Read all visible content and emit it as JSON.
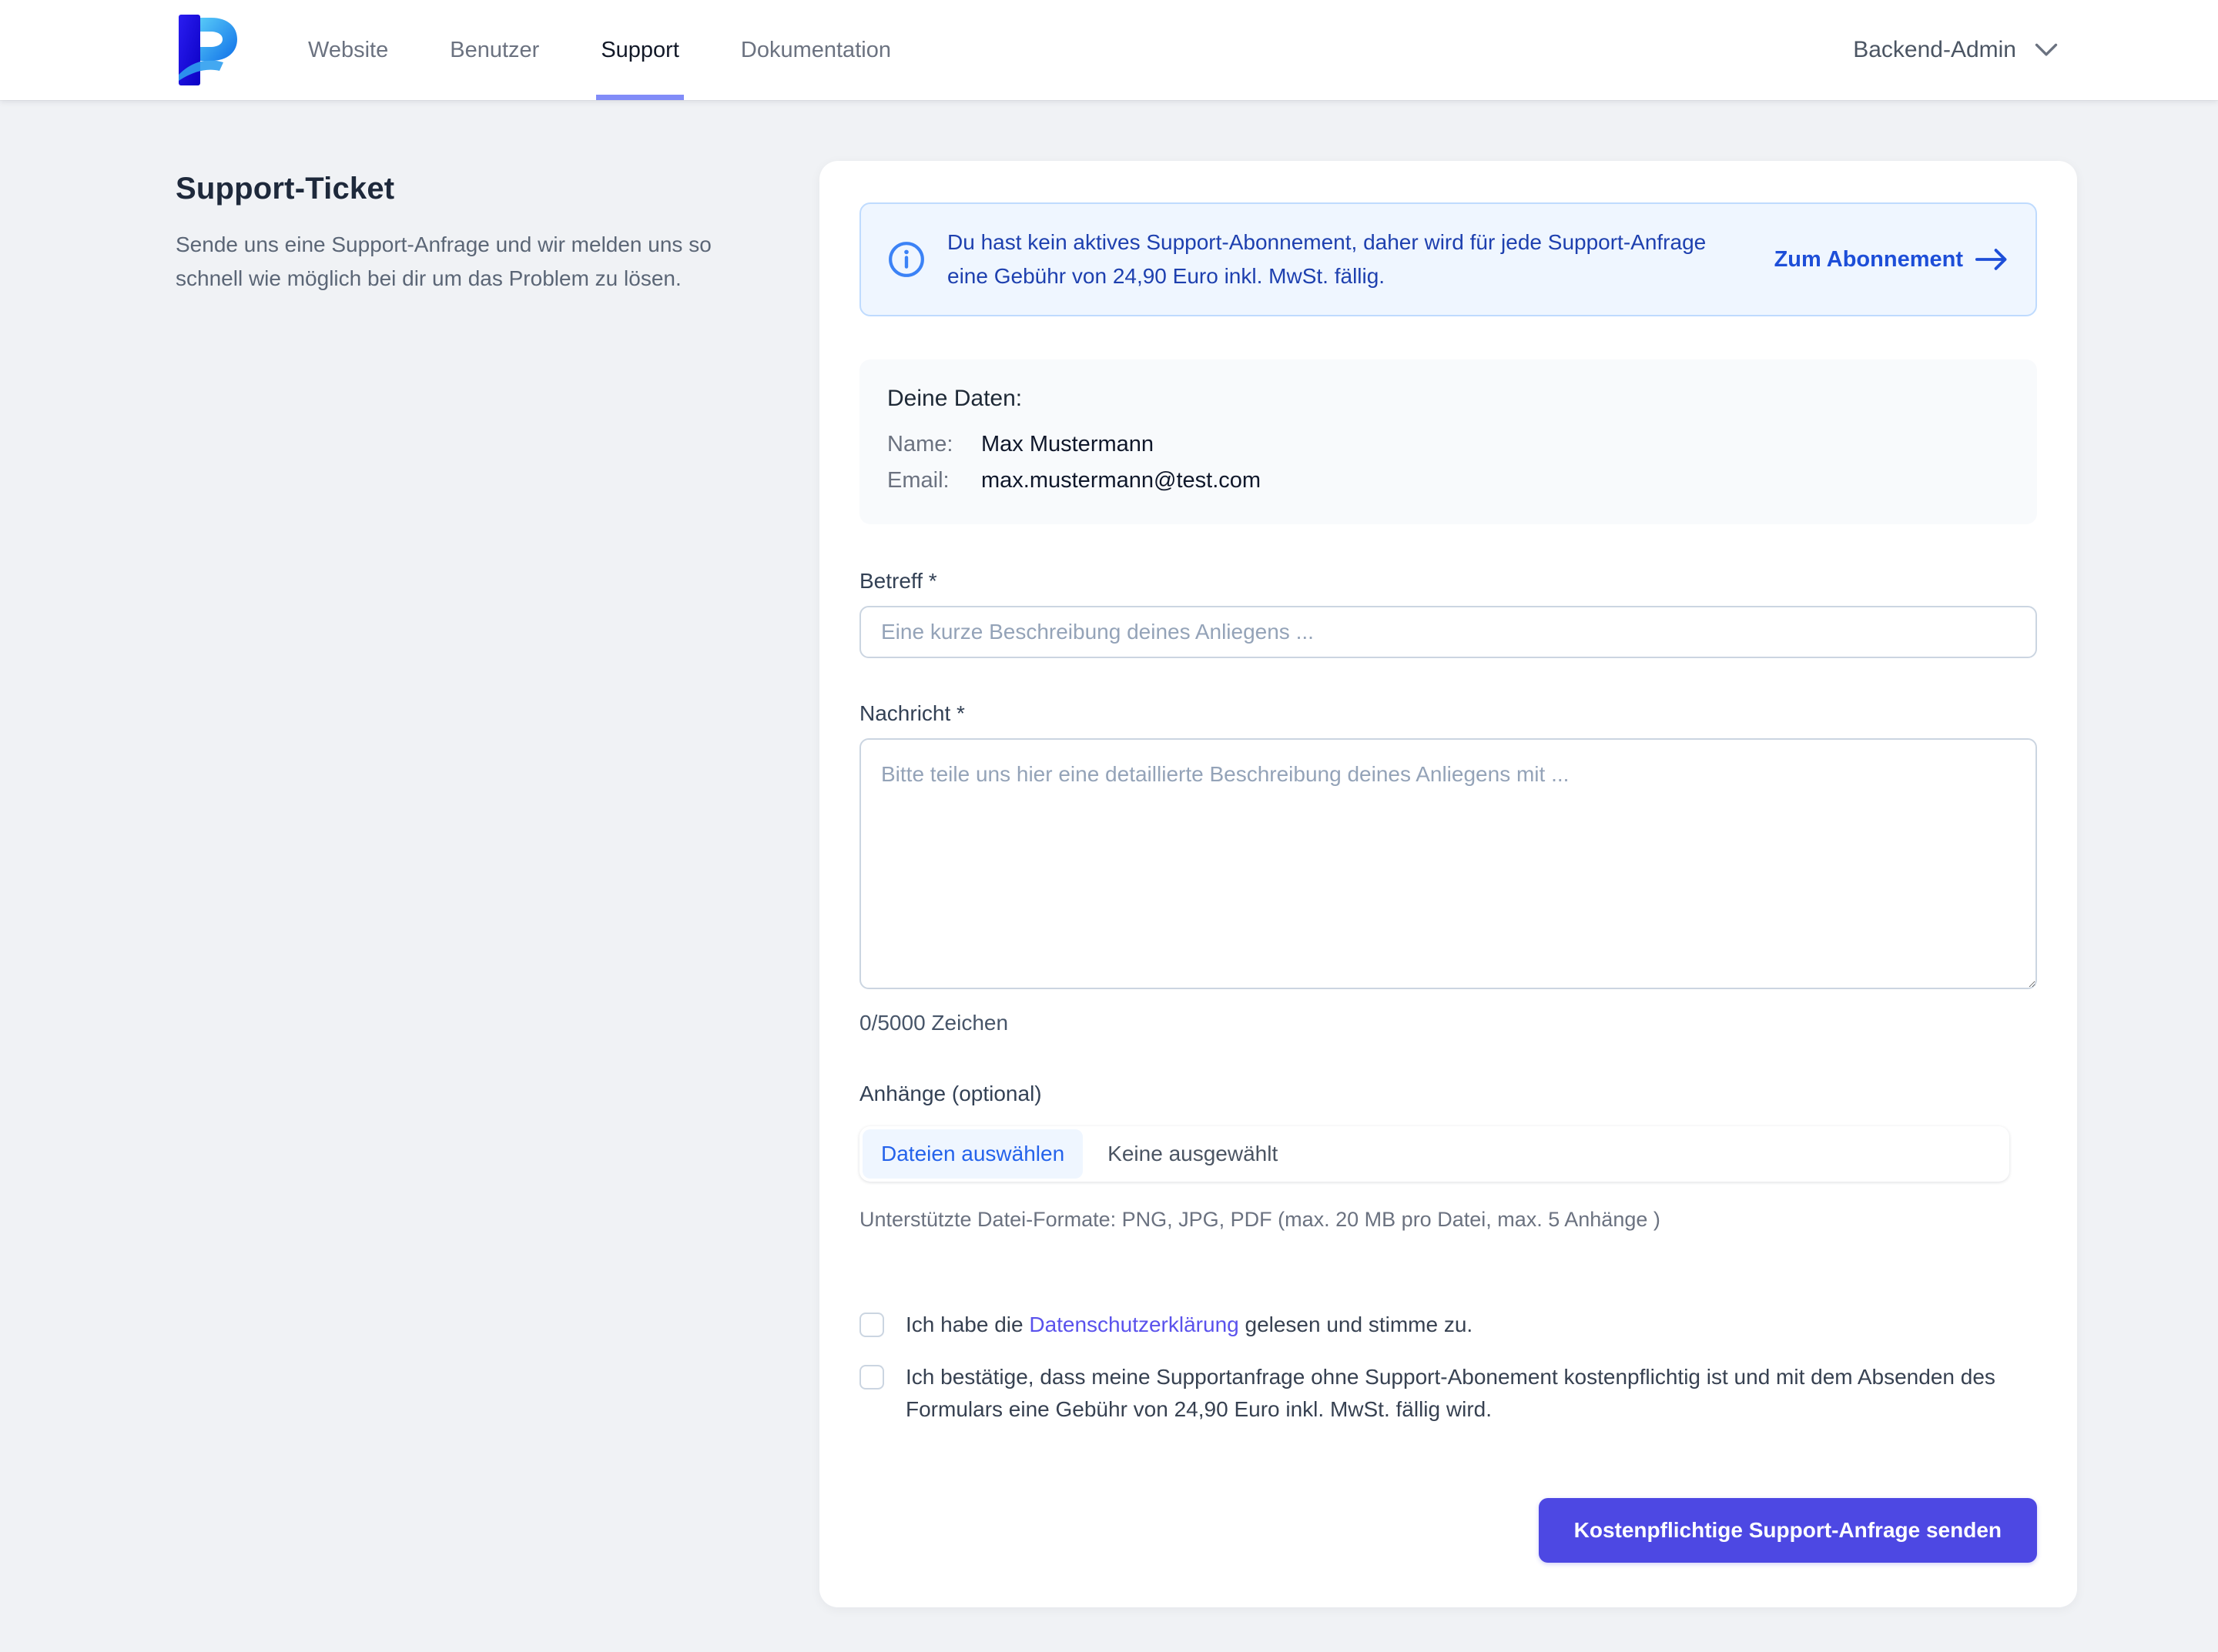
{
  "header": {
    "nav": [
      {
        "label": "Website",
        "active": false
      },
      {
        "label": "Benutzer",
        "active": false
      },
      {
        "label": "Support",
        "active": true
      },
      {
        "label": "Dokumentation",
        "active": false
      }
    ],
    "account_label": "Backend-Admin"
  },
  "intro": {
    "title": "Support-Ticket",
    "description": "Sende uns eine Support-Anfrage und wir melden uns so schnell wie möglich bei dir um das Problem zu lösen."
  },
  "banner": {
    "text": "Du hast kein aktives Support-Abonnement, daher wird für jede Support-Anfrage eine Gebühr von 24,90 Euro inkl. MwSt. fällig.",
    "link_label": "Zum Abonnement"
  },
  "user_data": {
    "title": "Deine Daten:",
    "name_label": "Name:",
    "name_value": "Max Mustermann",
    "email_label": "Email:",
    "email_value": "max.mustermann@test.com"
  },
  "form": {
    "subject": {
      "label": "Betreff *",
      "placeholder": "Eine kurze Beschreibung deines Anliegens ...",
      "value": ""
    },
    "message": {
      "label": "Nachricht *",
      "placeholder": "Bitte teile uns hier eine detaillierte Beschreibung deines Anliegens mit ...",
      "value": "",
      "counter": "0/5000 Zeichen"
    },
    "attachments": {
      "label": "Anhänge (optional)",
      "choose_button": "Dateien auswählen",
      "status": "Keine ausgewählt",
      "hint": "Unterstützte Datei-Formate: PNG, JPG, PDF (max. 20 MB pro Datei, max. 5 Anhänge )"
    },
    "consent_privacy": {
      "before": "Ich habe die ",
      "link": "Datenschutzerklärung",
      "after": " gelesen und stimme zu.",
      "checked": false
    },
    "consent_fee": {
      "text": "Ich bestätige, dass meine Supportanfrage ohne Support-Abonement kostenpflichtig ist und mit dem Absenden des Formulars eine Gebühr von 24,90 Euro inkl. MwSt. fällig wird.",
      "checked": false
    },
    "submit_label": "Kostenpflichtige Support-Anfrage senden"
  },
  "colors": {
    "accent": "#4d48e3",
    "link_indigo": "#5a52ec",
    "nav_underline": "#818cf8",
    "banner_bg": "#eff6ff",
    "banner_border": "#bfdbfe",
    "banner_text": "#1e40af",
    "banner_link": "#1d4ed8",
    "info_icon": "#3b82f6",
    "userbox_bg": "#f8fafc",
    "chip_bg": "#eff6ff",
    "chip_text": "#2563eb",
    "page_bg": "#f0f2f5"
  }
}
